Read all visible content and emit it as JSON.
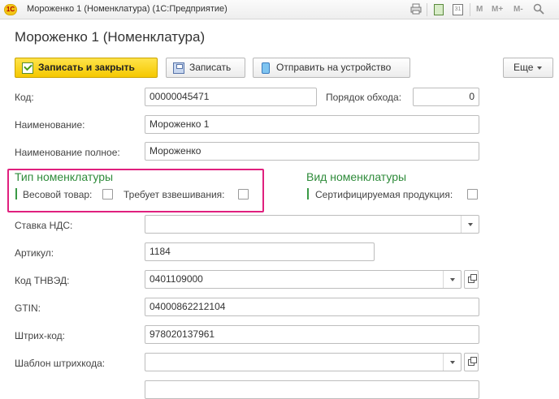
{
  "window": {
    "logo_text": "1С",
    "title": "Мороженко 1 (Номенклатура)  (1С:Предприятие)",
    "toolbar_icons": [
      "print-icon",
      "calculator-icon",
      "calendar-icon"
    ],
    "calendar_day": "31",
    "memory_buttons": [
      "M",
      "M+",
      "M-"
    ]
  },
  "form": {
    "title": "Мороженко 1 (Номенклатура)",
    "buttons": {
      "save_close": "Записать и закрыть",
      "save": "Записать",
      "send": "Отправить на устройство",
      "more": "Еще"
    },
    "fields": {
      "code_label": "Код:",
      "code_value": "00000045471",
      "order_label": "Порядок обхода:",
      "order_value": "0",
      "name_label": "Наименование:",
      "name_value": "Мороженко 1",
      "fullname_label": "Наименование полное:",
      "fullname_value": "Мороженко",
      "vat_label": "Ставка НДС:",
      "vat_value": "",
      "article_label": "Артикул:",
      "article_value": "1184",
      "tnved_label": "Код ТНВЭД:",
      "tnved_value": "0401109000",
      "gtin_label": "GTIN:",
      "gtin_value": "04000862212104",
      "barcode_label": "Штрих-код:",
      "barcode_value": "978020137961",
      "barcode_template_label": "Шаблон штрихкода:",
      "barcode_template_value": ""
    },
    "groups": {
      "type_title": "Тип номенклатуры",
      "weight_label": "Весовой товар:",
      "weight_checked": false,
      "weighing_label": "Требует взвешивания:",
      "weighing_checked": false,
      "kind_title": "Вид номенклатуры",
      "certified_label": "Сертифицируемая продукция:",
      "certified_checked": false
    }
  },
  "colors": {
    "primary_button": "#f5c800",
    "group_title": "#2e8b3a",
    "highlight_frame": "#e0207e"
  }
}
